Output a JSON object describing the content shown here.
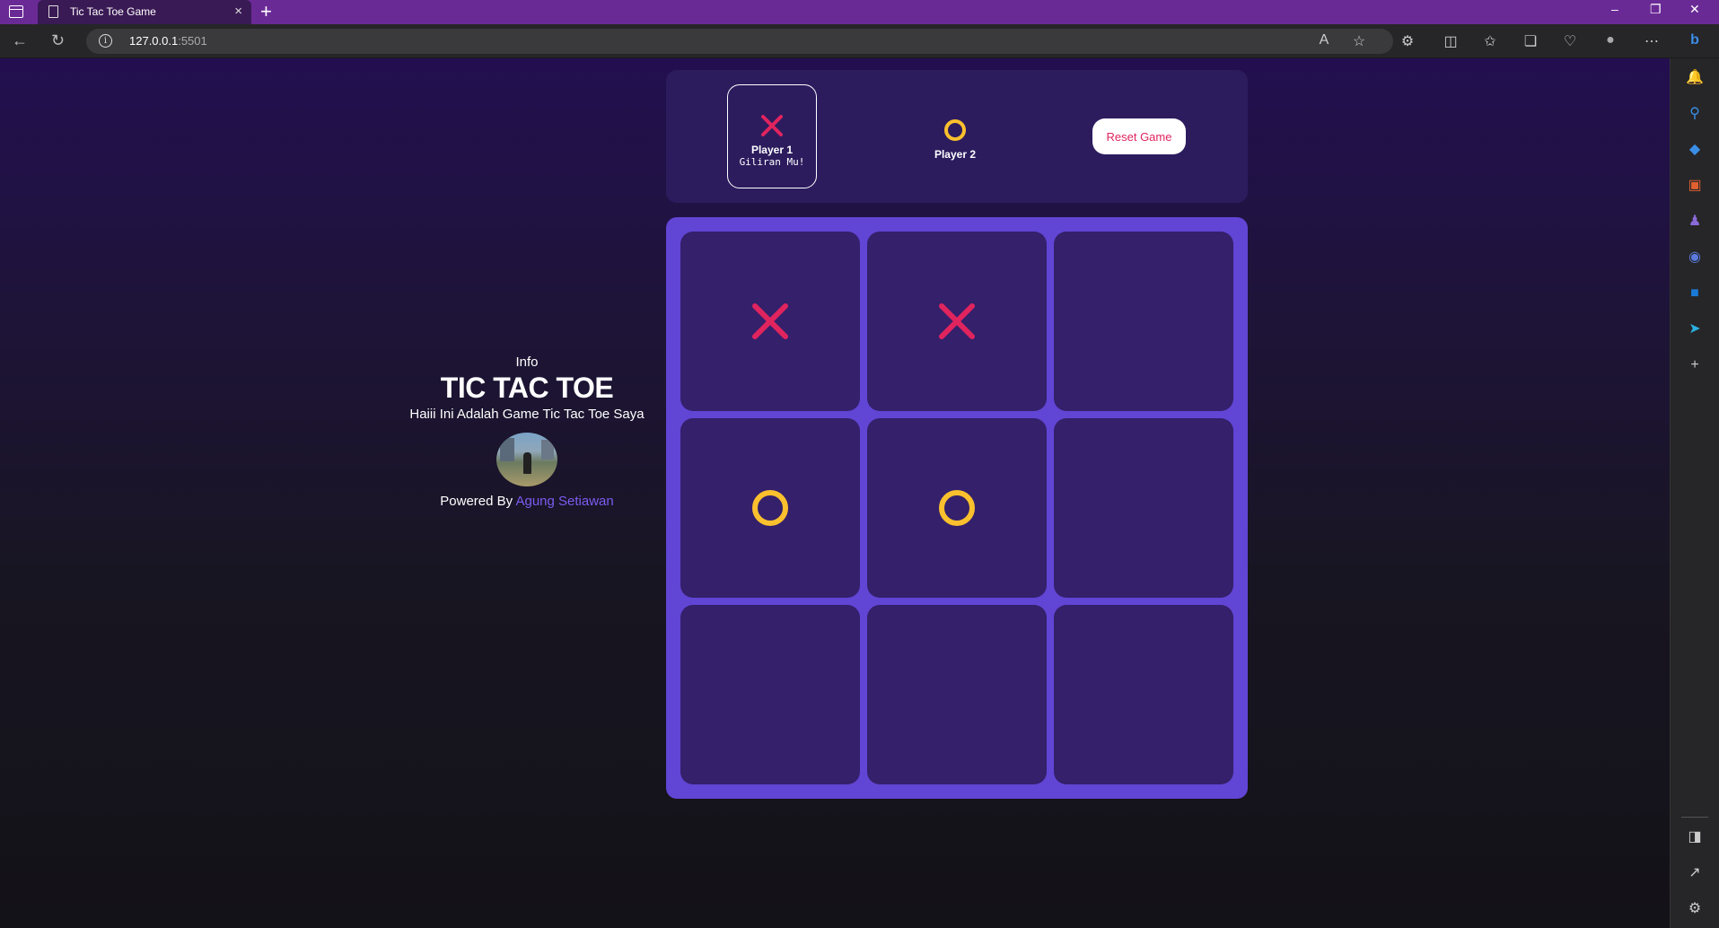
{
  "browser": {
    "tab_title": "Tic Tac Toe Game",
    "url_host": "127.0.0.1",
    "url_port": ":5501"
  },
  "info": {
    "label": "Info",
    "title": "TIC TAC TOE",
    "subtitle": "Haiii Ini Adalah Game Tic Tac Toe Saya",
    "powered_by": "Powered By",
    "author": "Agung Setiawan"
  },
  "players": {
    "p1": {
      "mark": "X",
      "name": "Player 1",
      "status": "Giliran Mu!"
    },
    "p2": {
      "mark": "O",
      "name": "Player 2"
    }
  },
  "reset_label": "Reset Game",
  "board": [
    [
      "X",
      "X",
      ""
    ],
    [
      "O",
      "O",
      ""
    ],
    [
      "",
      "",
      ""
    ]
  ],
  "colors": {
    "x": "#e0245e",
    "o": "#fbc02d",
    "board": "#6145d4",
    "cell": "#34206b",
    "panel": "#2c1c5e",
    "accent_link": "#7b5cf0"
  }
}
